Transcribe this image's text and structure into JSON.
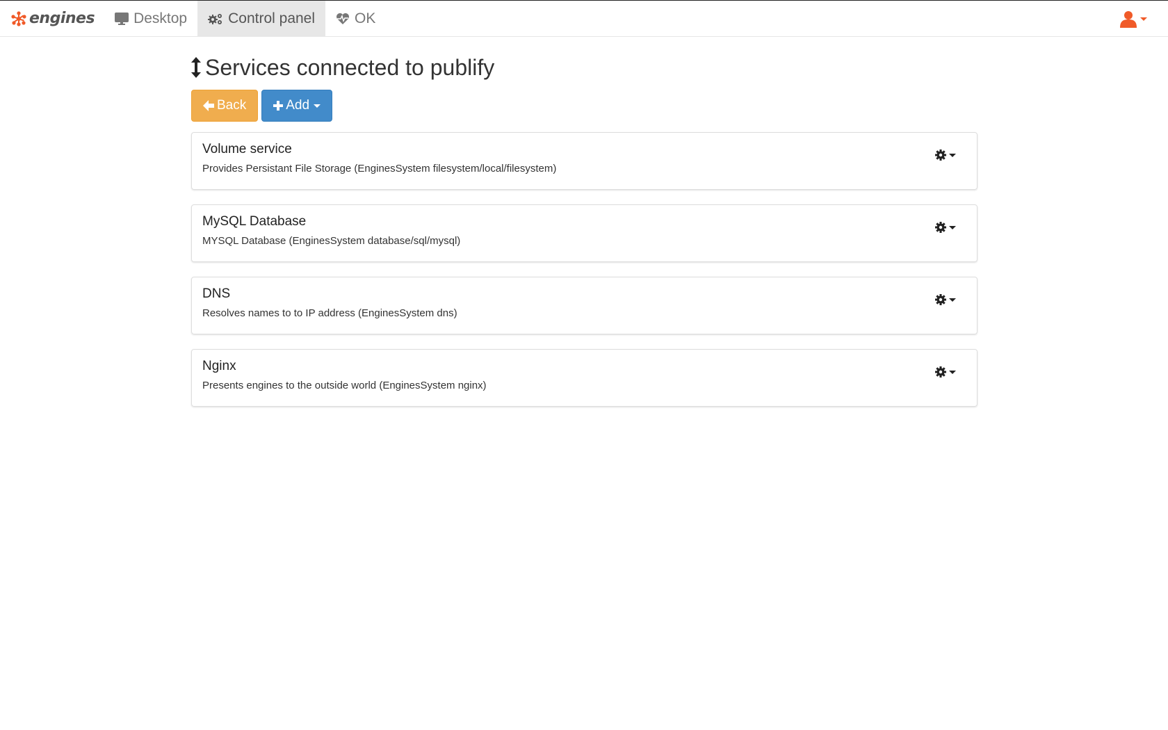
{
  "navbar": {
    "brand": "engines",
    "items": [
      {
        "label": "Desktop",
        "icon": "desktop-icon",
        "active": false
      },
      {
        "label": "Control panel",
        "icon": "cogs-icon",
        "active": true
      },
      {
        "label": "OK",
        "icon": "heartbeat-icon",
        "active": false
      }
    ],
    "user_icon": "user-icon"
  },
  "page": {
    "title": "Services connected to publify",
    "title_icon": "resize-vertical-icon"
  },
  "actions": {
    "back_label": "Back",
    "add_label": "Add"
  },
  "services": [
    {
      "title": "Volume service",
      "description": "Provides Persistant File Storage (EnginesSystem filesystem/local/filesystem)"
    },
    {
      "title": "MySQL Database",
      "description": "MYSQL Database (EnginesSystem database/sql/mysql)"
    },
    {
      "title": "DNS",
      "description": "Resolves names to to IP address (EnginesSystem dns)"
    },
    {
      "title": "Nginx",
      "description": "Presents engines to the outside world (EnginesSystem nginx)"
    }
  ],
  "colors": {
    "brand_accent": "#f05a28",
    "back_button": "#f0ad4e",
    "add_button": "#428bca",
    "active_nav": "#e7e7e7"
  }
}
